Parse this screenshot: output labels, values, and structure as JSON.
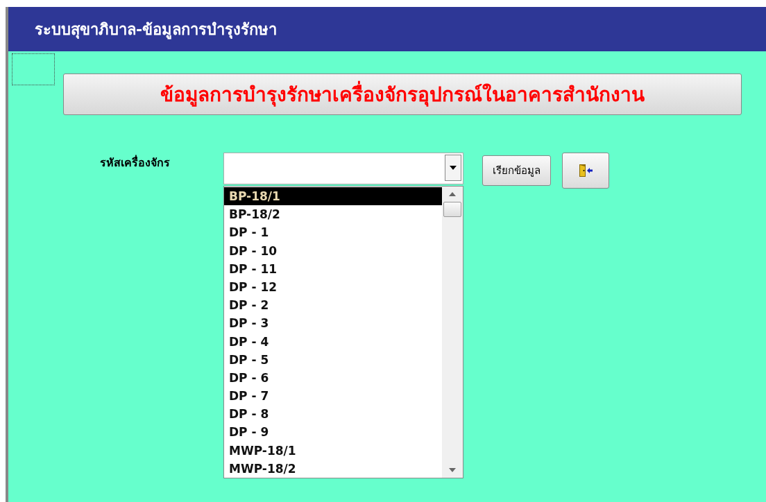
{
  "window": {
    "title": "ระบบสุขาภิบาล-ข้อมูลการบำรุงรักษา"
  },
  "heading": "ข้อมูลการบำรุงรักษาเครื่องจักรอุปกรณ์ในอาคารสำนักงาน",
  "machine_code": {
    "label": "รหัสเครื่องจักร",
    "open": true
  },
  "options": [
    {
      "label": "BP-18/1",
      "selected": true
    },
    {
      "label": "BP-18/2",
      "selected": false
    },
    {
      "label": "DP - 1",
      "selected": false
    },
    {
      "label": "DP - 10",
      "selected": false
    },
    {
      "label": "DP - 11",
      "selected": false
    },
    {
      "label": "DP - 12",
      "selected": false
    },
    {
      "label": "DP - 2",
      "selected": false
    },
    {
      "label": "DP - 3",
      "selected": false
    },
    {
      "label": "DP - 4",
      "selected": false
    },
    {
      "label": "DP - 5",
      "selected": false
    },
    {
      "label": "DP - 6",
      "selected": false
    },
    {
      "label": "DP - 7",
      "selected": false
    },
    {
      "label": "DP - 8",
      "selected": false
    },
    {
      "label": "DP - 9",
      "selected": false
    },
    {
      "label": "MWP-18/1",
      "selected": false
    },
    {
      "label": "MWP-18/2",
      "selected": false
    }
  ],
  "fetch_button": "เรียกข้อมูล"
}
